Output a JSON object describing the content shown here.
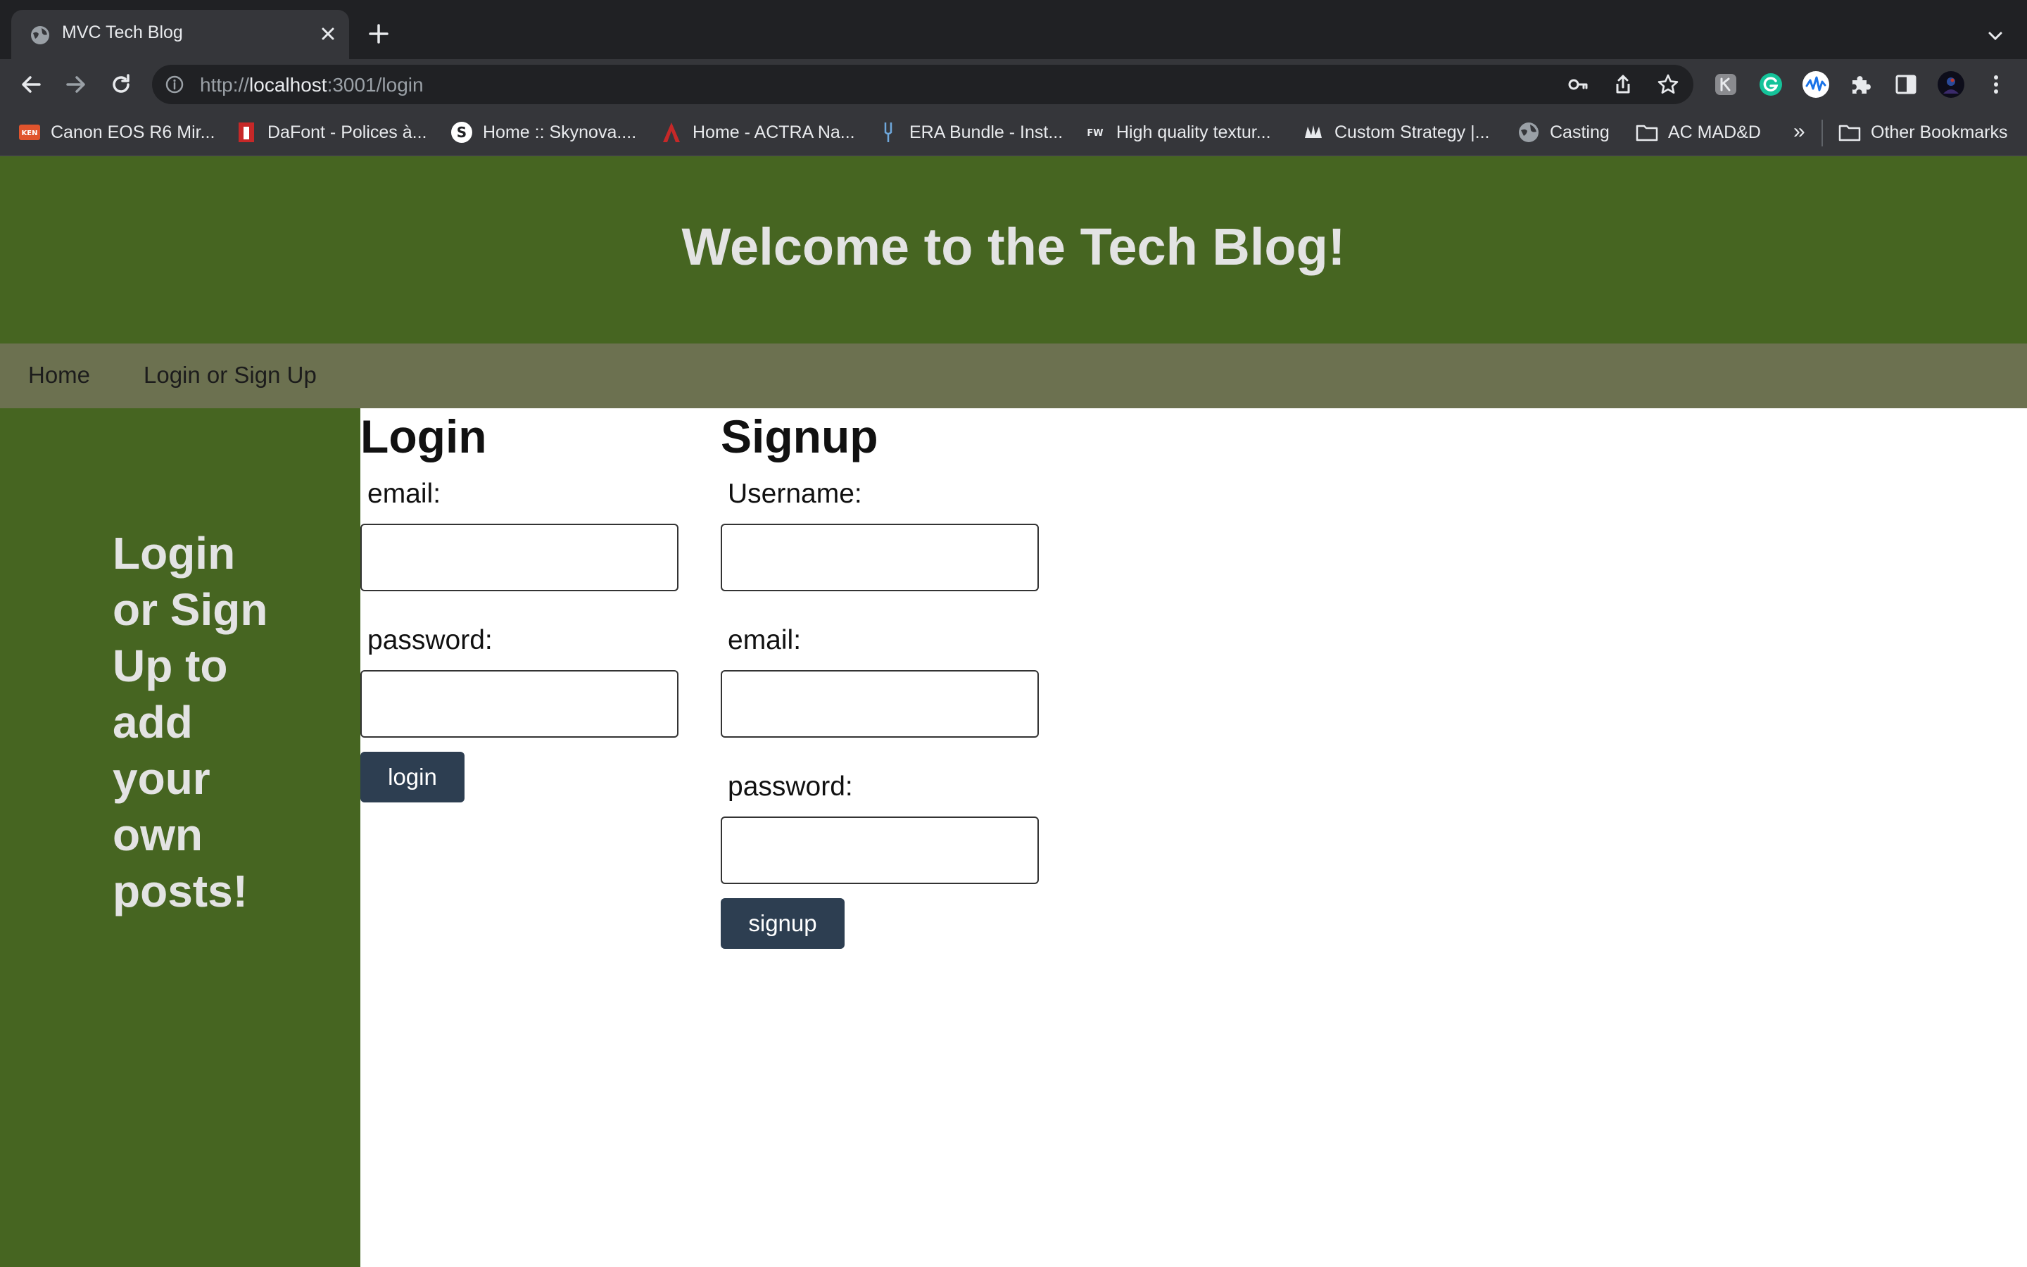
{
  "browser": {
    "tab": {
      "title": "MVC Tech Blog",
      "favicon": "globe-icon",
      "close_icon": "close-icon"
    },
    "new_tab_icon": "plus-icon",
    "tab_search_icon": "chevron-down-icon",
    "nav_icons": [
      "back-arrow-icon",
      "forward-arrow-icon",
      "reload-icon"
    ],
    "address_bar": {
      "scheme": "http://",
      "host": "localhost",
      "rest": ":3001/login",
      "leading_icon": "info-icon",
      "trailing_icons": [
        "key-icon",
        "share-icon",
        "star-icon"
      ]
    },
    "extensions": [
      "keyboard-extension-icon",
      "grammarly-icon",
      "audio-wave-extension-icon",
      "puzzle-icon",
      "side-panel-icon",
      "profile-avatar",
      "more-menu-icon"
    ],
    "bookmarks": [
      {
        "label": "Canon EOS R6 Mir...",
        "icon": "ken-favicon"
      },
      {
        "label": "DaFont - Polices à...",
        "icon": "dafont-favicon"
      },
      {
        "label": "Home :: Skynova....",
        "icon": "skynova-favicon"
      },
      {
        "label": "Home - ACTRA Na...",
        "icon": "actra-favicon"
      },
      {
        "label": "ERA Bundle - Inst...",
        "icon": "tuning-fork-favicon"
      },
      {
        "label": "High quality textur...",
        "icon": "fw-favicon"
      },
      {
        "label": "Custom Strategy |...",
        "icon": "strategy-favicon"
      },
      {
        "label": "Casting",
        "icon": "globe-icon"
      },
      {
        "label": "AC MAD&D",
        "icon": "folder-icon"
      }
    ],
    "bookmarks_overflow": "»",
    "other_bookmarks": {
      "label": "Other Bookmarks",
      "icon": "folder-icon"
    }
  },
  "site": {
    "title": "Welcome to the Tech Blog!",
    "nav": [
      "Home",
      "Login or Sign Up"
    ],
    "sidebar_text": "Login or Sign Up to add your own posts!"
  },
  "login": {
    "heading": "Login",
    "email_label": "email:",
    "email_value": "",
    "password_label": "password:",
    "password_value": "",
    "button": "login"
  },
  "signup": {
    "heading": "Signup",
    "username_label": "Username:",
    "username_value": "",
    "email_label": "email:",
    "email_value": "",
    "password_label": "password:",
    "password_value": "",
    "button": "signup"
  },
  "colors": {
    "header_green": "#466521",
    "nav_olive": "#6c7150",
    "button_navy": "#2d3e51",
    "header_text": "#e3e3e3"
  }
}
